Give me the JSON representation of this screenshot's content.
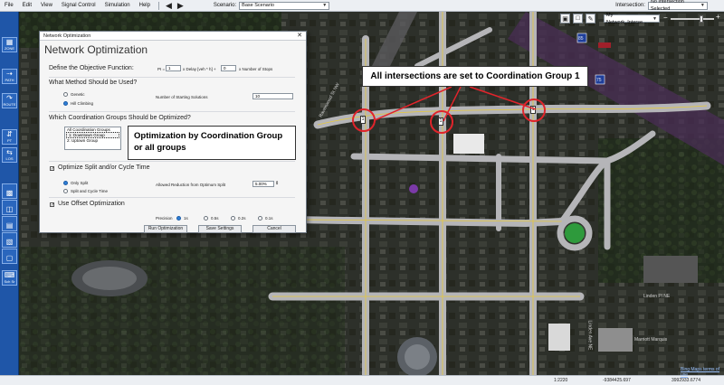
{
  "menu": {
    "items": [
      "File",
      "Edit",
      "View",
      "Signal Control",
      "Simulation",
      "Help"
    ],
    "scenario_label": "Scenario:",
    "scenario_value": "Base Scenario",
    "intersection_label": "Intersection:",
    "intersection_value": "No Intersection Selected"
  },
  "left_toolbar": {
    "buttons": [
      "ZONE",
      "PATH",
      "ROUTE",
      "PT",
      "LOS",
      "",
      "Sch Sr",
      ""
    ]
  },
  "map": {
    "layer_selector": "My Network_Interse...",
    "street_labels": [
      "Ravenwood St NW",
      "Linden Pl NE",
      "Linden Ave NE",
      "Marriott Marquis"
    ],
    "highway_shields": [
      "85",
      "75"
    ]
  },
  "dialog": {
    "title": "Network Optimization",
    "heading": "Network Optimization",
    "objective_label": "Define the Objective Function:",
    "pi_label": "PI =",
    "delay_weight": "1",
    "delay_text": "x Delay [veh * h] +",
    "stops_weight": "0",
    "stops_text": "x Number of Stops",
    "method_label": "What Method Should be Used?",
    "method_genetic": "Genetic",
    "method_hill": "Hill Climbing",
    "starting_label": "Number of Starting Solutions",
    "starting_value": "10",
    "groups_label": "Which Coordination Groups Should be Optimized?",
    "groups": [
      "All Coordination Groups",
      "1: Downtown Group",
      "2: Uptown Group"
    ],
    "split_label": "Optimize Split and/or Cycle Time",
    "only_split": "Only Split",
    "split_cycle": "Split and Cycle Time",
    "allowed_label": "Allowed Reduction from Optimum Split",
    "allowed_value": "5.00%",
    "offset_label": "Use Offset Optimization",
    "precision_label": "Precision",
    "precision_options": [
      "1s",
      "0.5s",
      "0.2s",
      "0.1s"
    ],
    "run_button": "Run Optimization",
    "save_button": "Save Settings",
    "cancel_button": "Cancel"
  },
  "callouts": {
    "coordination": "All intersections are set to Coordination Group 1",
    "groups_line1": "Optimization by Coordination Group",
    "groups_line2": "or all groups"
  },
  "signals": [
    "1",
    "1",
    "1"
  ],
  "status": {
    "scale": "1:2220",
    "x": "-9384425.697",
    "y": "3992933.6774",
    "bing": "Bing Maps terms of use"
  },
  "colors": {
    "toolbar_blue": "#1f56a8",
    "road": "#b5b5b8",
    "callout_ring": "#e0242b",
    "roundabout": "#2e9a3c"
  }
}
